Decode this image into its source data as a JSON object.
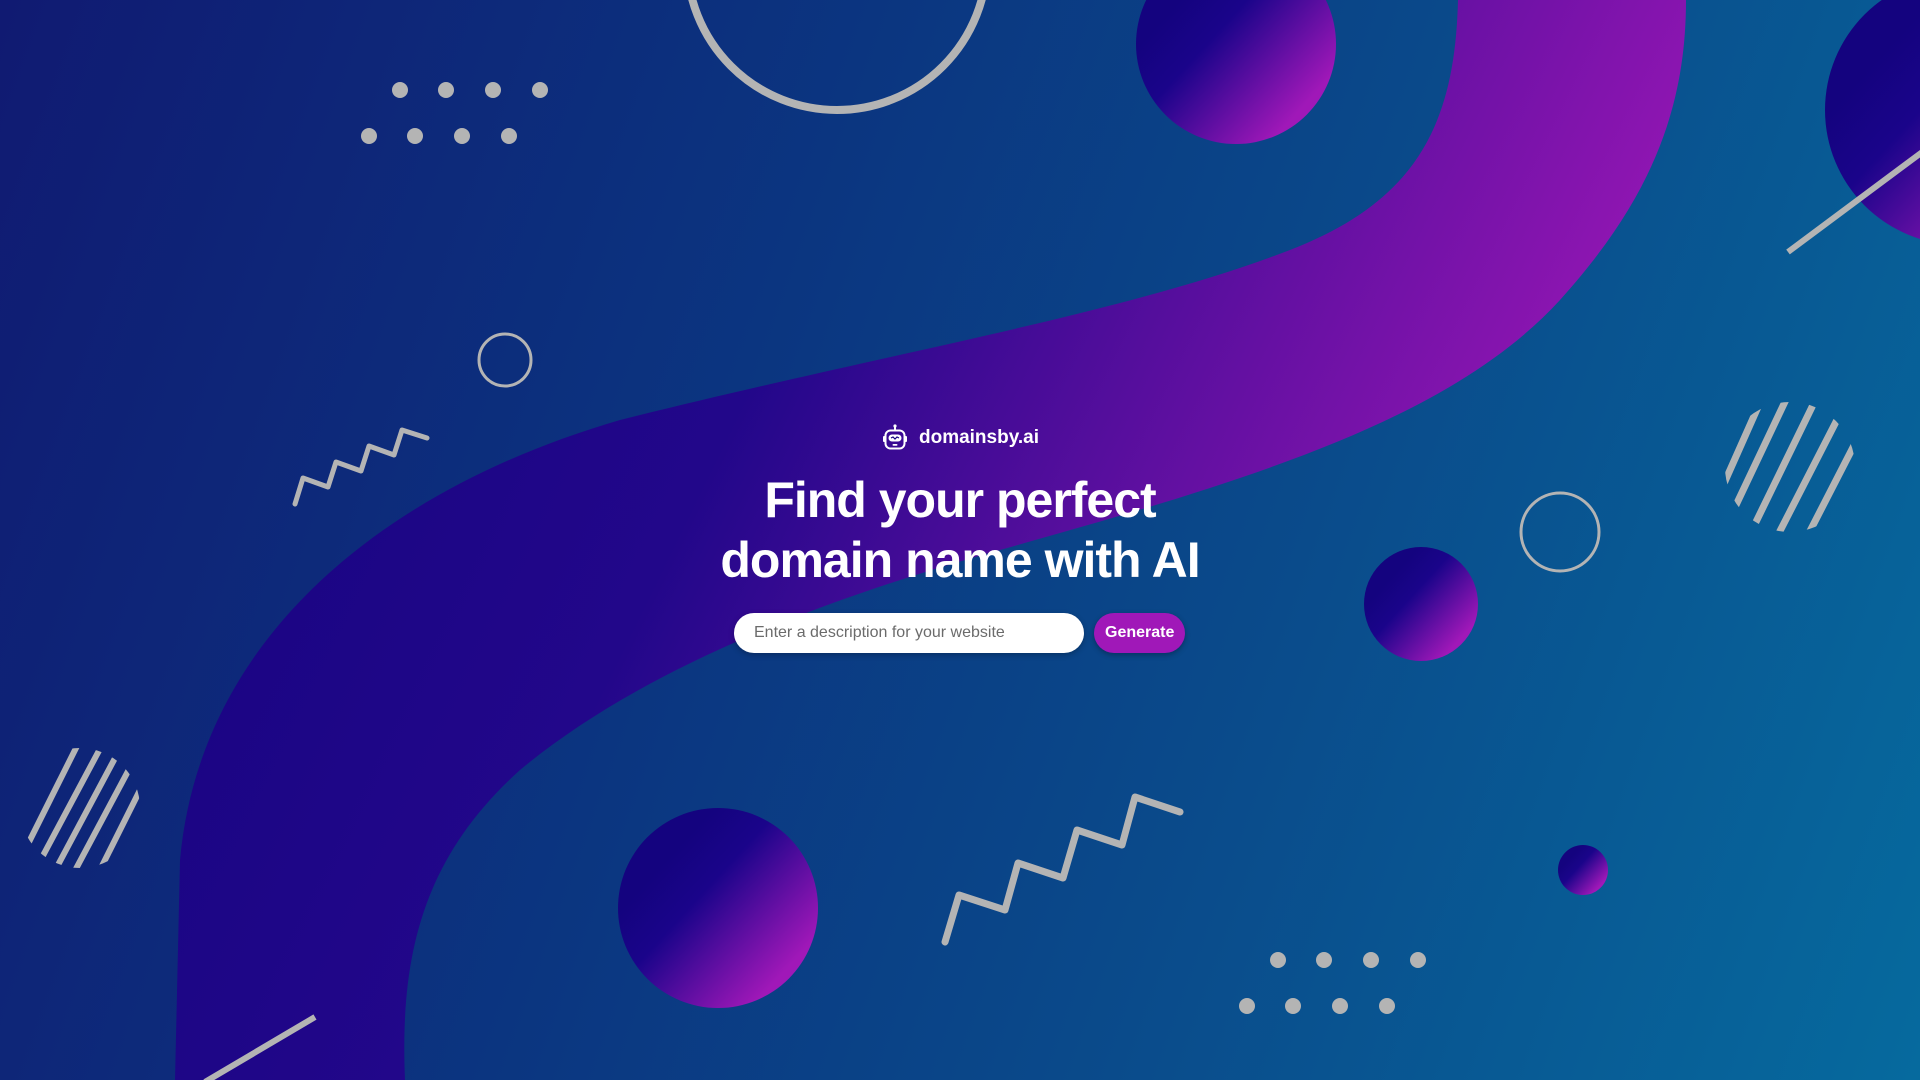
{
  "brand": {
    "name": "domainsby.ai",
    "icon": "robot-icon"
  },
  "hero": {
    "headline_line1": "Find your perfect",
    "headline_line2": "domain name with AI"
  },
  "search": {
    "placeholder": "Enter a description for your website",
    "value": "",
    "button_label": "Generate"
  },
  "theme": {
    "background_start": "#101a72",
    "background_end": "#066a9e",
    "tube_dark": "#14037f",
    "tube_accent": "#a018b8",
    "decor_gray": "#b4b4b4",
    "button_color": "#a018b8"
  },
  "decorations": {
    "icons": [
      "ring-icon",
      "sphere-icon",
      "dot-grid-icon",
      "zigzag-icon",
      "hatched-circle-icon",
      "line-icon"
    ]
  }
}
